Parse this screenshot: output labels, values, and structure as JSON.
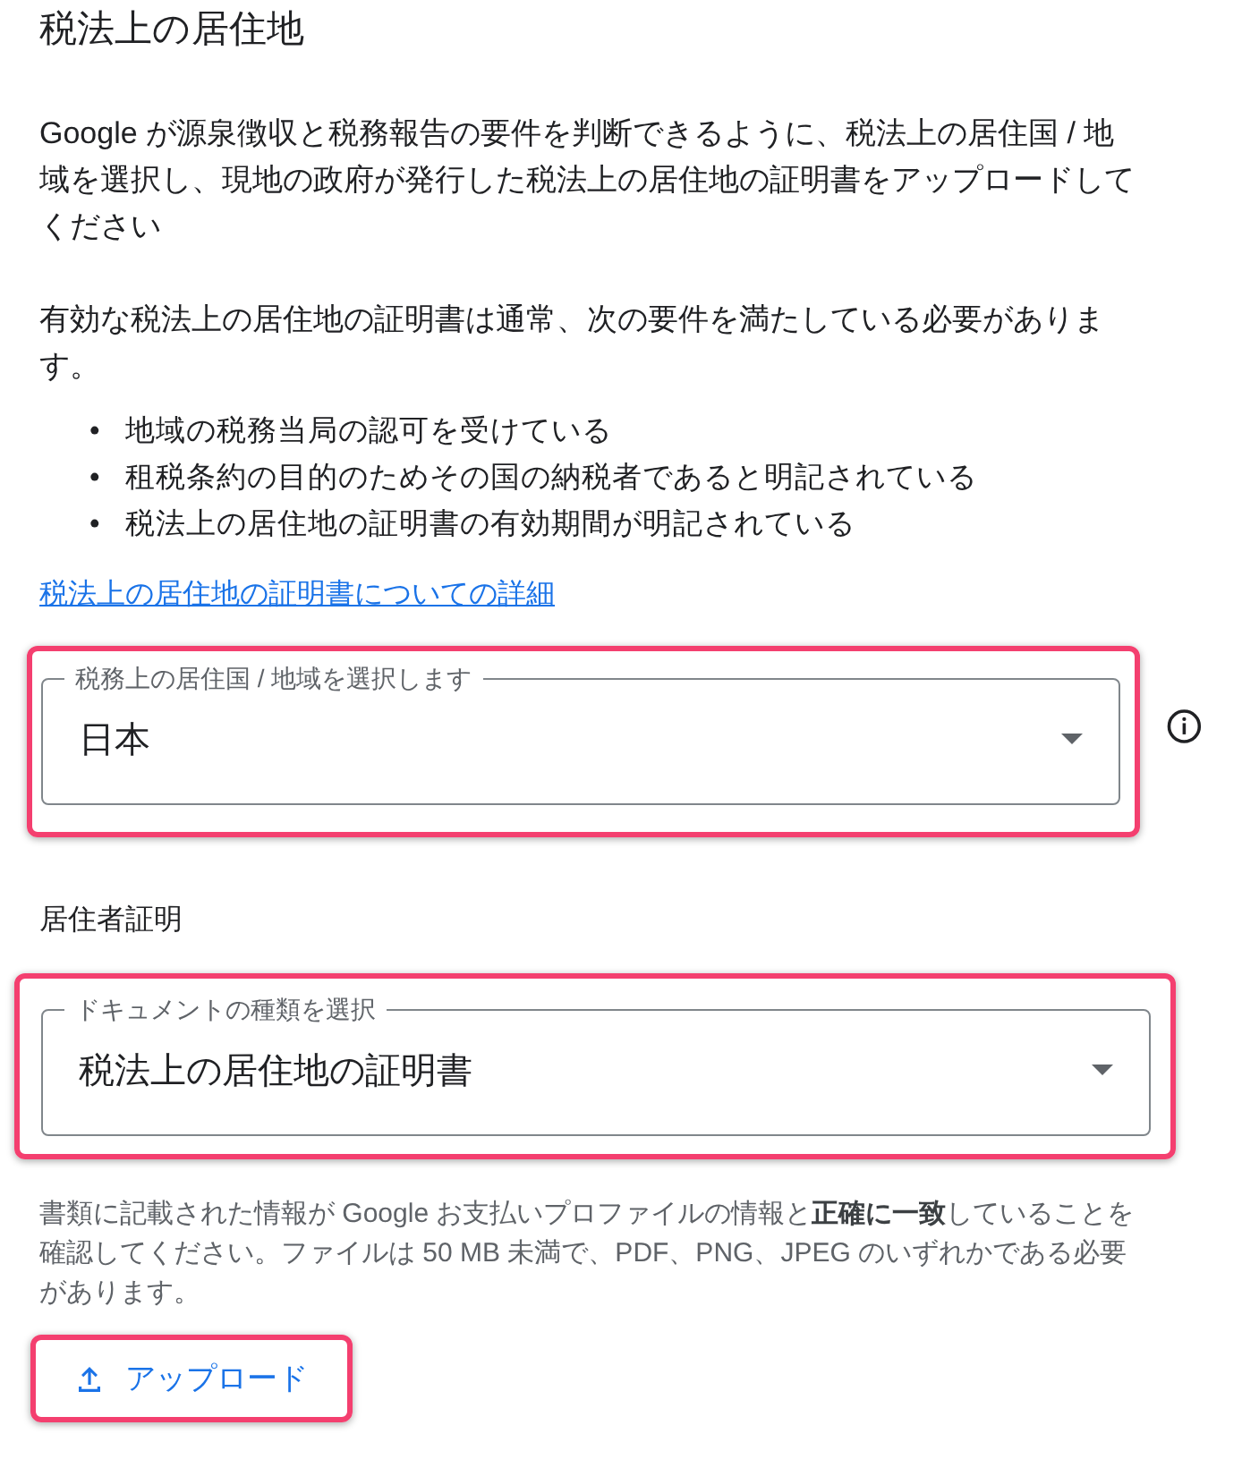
{
  "title": "税法上の居住地",
  "intro": "Google が源泉徴収と税務報告の要件を判断できるように、税法上の居住国 / 地域を選択し、現地の政府が発行した税法上の居住地の証明書をアップロードしてください",
  "requirements_intro": "有効な税法上の居住地の証明書は通常、次の要件を満たしている必要があります。",
  "requirements": [
    {
      "bullet": "•",
      "text": "地域の税務当局の認可を受けている"
    },
    {
      "bullet": "•",
      "text": "租税条約の目的のためその国の納税者であると明記されている"
    },
    {
      "bullet": "•",
      "text": "税法上の居住地の証明書の有効期間が明記されている"
    }
  ],
  "details_link": "税法上の居住地の証明書についての詳細",
  "country_select": {
    "label": "税務上の居住国 / 地域を選択します",
    "value": "日本",
    "highlighted": true,
    "info_icon": true
  },
  "section_heading": "居住者証明",
  "document_select": {
    "label": "ドキュメントの種類を選択",
    "value": "税法上の居住地の証明書",
    "highlighted": true
  },
  "helper_text": "書類に記載された情報が Google お支払いプロファイルの情報と**正確に一致**していることを確認してください。ファイルは 50 MB 未満で、PDF、PNG、JPEG のいずれかである必要があります。",
  "upload_button": {
    "label": "アップロード",
    "highlighted": true
  }
}
